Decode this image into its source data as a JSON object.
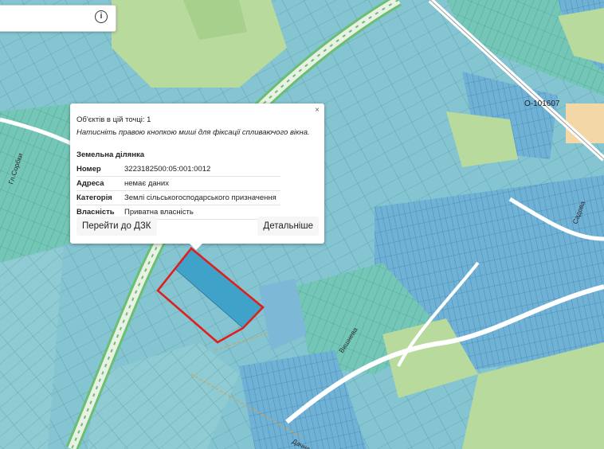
{
  "colors": {
    "road": "#ffffff",
    "highway": "#67b86e",
    "highlight_outline": "#e11d1d",
    "forest": "#b7d99a",
    "parcel_teal": "#66ccb6",
    "parcel_blue": "#7db9d9",
    "selected_parcel": "#3ea2c9"
  },
  "search": {
    "info_icon": "info-circle-icon",
    "info_glyph": "i"
  },
  "map": {
    "labels": {
      "road_code": "О-101607",
      "street_left": "Гл.Сорбки",
      "street_center": "Вишнева",
      "street_bottom": "Дачна",
      "street_right": "Садова"
    }
  },
  "popup": {
    "close_glyph": "×",
    "count_text": "Об'єктів в цій точці: 1",
    "hint_text": "Натисніть правою кнопкою миші для фіксації спливаючого вікна.",
    "section_title": "Земельна ділянка",
    "rows": [
      {
        "key": "Номер",
        "value": "3223182500:05:001:0012"
      },
      {
        "key": "Адреса",
        "value": "немає даних"
      },
      {
        "key": "Категорія",
        "value": "Землі сільськогосподарського призначення"
      },
      {
        "key": "Власність",
        "value": "Приватна власність"
      }
    ],
    "btn_dzk": "Перейти до ДЗК",
    "btn_more": "Детальніше"
  }
}
